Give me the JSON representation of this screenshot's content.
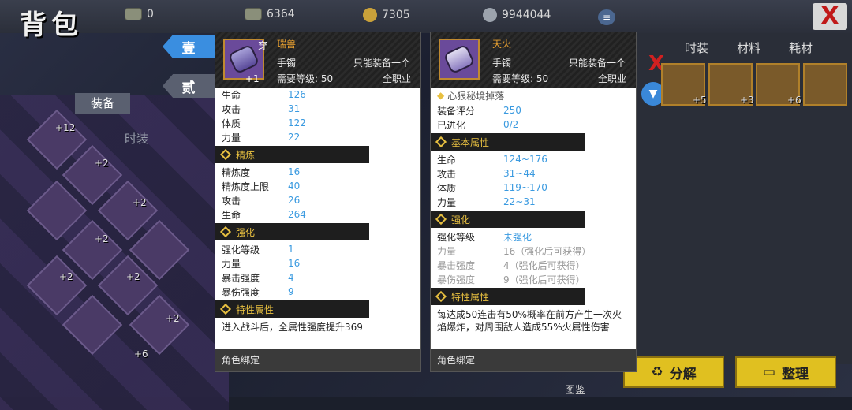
{
  "top": {
    "logo": "背包",
    "resources": [
      "0",
      "6364",
      "7305",
      "9944044"
    ],
    "close": "X"
  },
  "left": {
    "tabs": [
      "装备",
      "时装"
    ],
    "num_tabs": [
      "壹",
      "贰"
    ],
    "badges": [
      "+12",
      "+2",
      "+2",
      "+2",
      "+2",
      "+2",
      "+6",
      "+2"
    ]
  },
  "right": {
    "tabs": [
      "时装",
      "材料",
      "耗材"
    ],
    "badges": [
      "+5",
      "+3",
      "+6"
    ],
    "close": "X",
    "buttons": {
      "decompose": "分解",
      "organize": "整理"
    },
    "tujian": "图鉴"
  },
  "card1": {
    "wear": "穿",
    "name": "瑞兽",
    "type": "手镯",
    "limit": "只能装备一个",
    "req_label": "需要等级: 50",
    "profession": "全职业",
    "level": "+1",
    "stats": [
      {
        "k": "生命",
        "v": "126"
      },
      {
        "k": "攻击",
        "v": "31"
      },
      {
        "k": "体质",
        "v": "122"
      },
      {
        "k": "力量",
        "v": "22"
      }
    ],
    "refine_title": "精炼",
    "refine": [
      {
        "k": "精炼度",
        "v": "16"
      },
      {
        "k": "精炼度上限",
        "v": "40"
      },
      {
        "k": "攻击",
        "v": "26"
      },
      {
        "k": "生命",
        "v": "264"
      }
    ],
    "enhance_title": "强化",
    "enhance": [
      {
        "k": "强化等级",
        "v": "1"
      },
      {
        "k": "力量",
        "v": "16"
      },
      {
        "k": "暴击强度",
        "v": "4"
      },
      {
        "k": "暴伤强度",
        "v": "9"
      }
    ],
    "trait_title": "特性属性",
    "trait_desc": "进入战斗后，全属性强度提升369",
    "foot": "角色绑定"
  },
  "card2": {
    "name": "天火",
    "type": "手镯",
    "limit": "只能装备一个",
    "req_label": "需要等级: 50",
    "profession": "全职业",
    "special": "心狠秘境掉落",
    "score": [
      {
        "k": "装备评分",
        "v": "250"
      },
      {
        "k": "已进化",
        "v": "0/2"
      }
    ],
    "base_title": "基本属性",
    "base": [
      {
        "k": "生命",
        "v": "124~176"
      },
      {
        "k": "攻击",
        "v": "31~44"
      },
      {
        "k": "体质",
        "v": "119~170"
      },
      {
        "k": "力量",
        "v": "22~31"
      }
    ],
    "enhance_title": "强化",
    "enhance": [
      {
        "k": "强化等级",
        "v": "未强化"
      },
      {
        "k": "力量",
        "v": "16（强化后可获得）"
      },
      {
        "k": "暴击强度",
        "v": "4（强化后可获得）"
      },
      {
        "k": "暴伤强度",
        "v": "9（强化后可获得）"
      }
    ],
    "trait_title": "特性属性",
    "trait_desc": "每达成50连击有50%概率在前方产生一次火焰爆炸，对周围敌人造成55%火属性伤害",
    "foot": "角色绑定"
  }
}
